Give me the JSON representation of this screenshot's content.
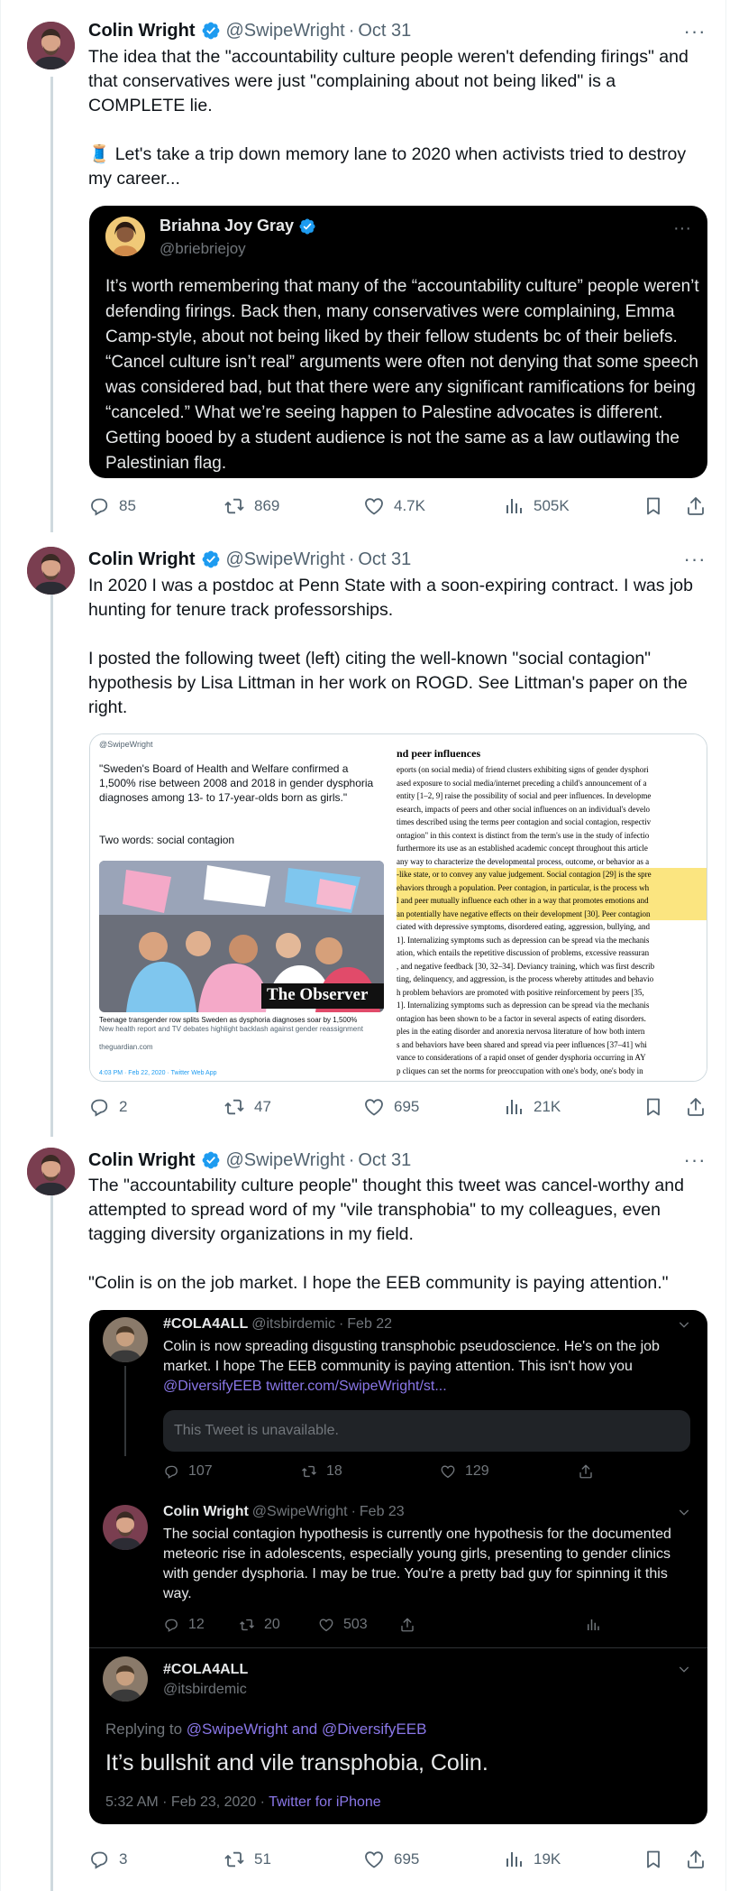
{
  "colors": {
    "accent": "#1d9bf0",
    "text": "#0f1419",
    "muted": "#536471",
    "dark_bg": "#000000",
    "purple_link": "#8a77e8"
  },
  "tweets": [
    {
      "author_name": "Colin Wright",
      "author_handle": "@SwipeWright",
      "date": "Oct 31",
      "paragraphs": [
        "The idea that the \"accountability culture people weren't defending firings\" and that conservatives were just \"complaining about not being liked\" is a COMPLETE lie.",
        "🧵 Let's take a trip down memory lane to 2020 when activists tried to destroy my career..."
      ],
      "quote": {
        "author_name": "Briahna Joy Gray",
        "author_handle": "@briebriejoy",
        "text": "It’s worth remembering that many of the “accountability culture” people weren’t defending firings. Back then, many conservatives were complaining, Emma Camp-style, about not being liked by their fellow students bc of their beliefs. “Cancel culture isn’t real” arguments were often not denying that some speech was considered bad, but that there were any significant ramifications for being “canceled.” What we’re seeing happen to Palestine advocates is different. Getting booed by a student audience is not the same as a law outlawing the Palestinian flag."
      },
      "stats": {
        "replies": "85",
        "retweets": "869",
        "likes": "4.7K",
        "views": "505K"
      }
    },
    {
      "author_name": "Colin Wright",
      "author_handle": "@SwipeWright",
      "date": "Oct 31",
      "paragraphs": [
        "In 2020 I was a postdoc at Penn State with a soon-expiring contract. I was job hunting for tenure track professorships.",
        "I posted the following tweet (left) citing the well-known \"social contagion\" hypothesis by Lisa Littman in her work on ROGD. See Littman's paper on the right."
      ],
      "image": {
        "left": {
          "handle": "@SwipeWright",
          "quote": "\"Sweden's Board of Health and Welfare confirmed a 1,500% rise between 2008 and 2018 in gender dysphoria diagnoses among 13- to 17-year-olds born as girls.\"",
          "words": "Two words: social contagion",
          "banner": "The Observer",
          "caption": "Teenage transgender row splits Sweden as dysphoria diagnoses soar by 1,500%",
          "subcaption": "New health report and TV debates highlight backlash against gender reassignment",
          "source": "theguardian.com",
          "footer": "4:03 PM · Feb 22, 2020 · Twitter Web App"
        },
        "right": {
          "heading": "nd peer influences",
          "lines": [
            "eports (on social media) of friend clusters exhibiting signs of gender dysphori",
            "ased exposure to social media/internet preceding a child's announcement of a",
            "entity [1–2, 9] raise the possibility of social and peer influences. In developme",
            "esearch, impacts of peers and other social influences on an individual's develo",
            "times described using the terms peer contagion and social contagion, respectiv",
            "ontagion\" in this context is distinct from the term's use in the study of infectio",
            " furthermore its use as an established academic concept throughout this article",
            " any way to characterize the developmental process, outcome, or behavior as a",
            "-like state, or to convey any value judgement. Social contagion [29] is the spre",
            "ehaviors through a population. Peer contagion, in particular, is the process wh",
            "l and peer mutually influence each other in a way that promotes emotions and",
            "an potentially have negative effects on their development [30]. Peer contagion",
            "ciated with depressive symptoms, disordered eating, aggression, bullying, and",
            "1]. Internalizing symptoms such as depression can be spread via the mechanis",
            "ation, which entails the repetitive discussion of problems, excessive reassuran",
            ", and negative feedback [30, 32–34]. Deviancy training, which was first describ",
            "ting, delinquency, and aggression, is the process whereby attitudes and behavio",
            "h problem behaviors are promoted with positive reinforcement by peers [35,",
            "1]. Internalizing symptoms such as depression can be spread via the mechanis",
            "ontagion has been shown to be a factor in several aspects of eating disorders.",
            "ples in the eating disorder and anorexia nervosa literature of how both intern",
            "s and behaviors have been shared and spread via peer influences [37–41] whi",
            "vance to considerations of a rapid onset of gender dysphoria occurring in AY",
            "p cliques can set the norms for preoccupation with one's body, one's body in"
          ]
        }
      },
      "stats": {
        "replies": "2",
        "retweets": "47",
        "likes": "695",
        "views": "21K"
      }
    },
    {
      "author_name": "Colin Wright",
      "author_handle": "@SwipeWright",
      "date": "Oct 31",
      "paragraphs": [
        "The \"accountability culture people\" thought this tweet was cancel-worthy and attempted to spread word of my \"vile transphobia\" to my colleagues, even tagging diversity organizations in my field.",
        "\"Colin is on the job market. I hope the EEB community is paying attention.\""
      ],
      "embed": {
        "t1": {
          "name": "#COLA4ALL",
          "handle": "@itsbirdemic",
          "date": "Feb 22",
          "text": "Colin is now spreading disgusting transphobic pseudoscience. He's on the job market. I hope The EEB community is paying attention. This isn't how you ",
          "link": "@DiversifyEEB twitter.com/SwipeWright/st...",
          "unavailable": "This Tweet is unavailable.",
          "replies": "107",
          "retweets": "18",
          "likes": "129"
        },
        "t2": {
          "name": "Colin Wright",
          "handle": "@SwipeWright",
          "date": "Feb 23",
          "text": "The social contagion hypothesis is currently one hypothesis for the documented meteoric rise in adolescents, especially young girls, presenting to gender clinics with gender dysphoria. I may be true. You're a pretty bad guy for spinning it this way.",
          "replies": "12",
          "retweets": "20",
          "likes": "503"
        },
        "t3": {
          "name": "#COLA4ALL",
          "handle": "@itsbirdemic",
          "replying_prefix": "Replying to ",
          "replying_to": "@SwipeWright and @DiversifyEEB",
          "text": "It’s bullshit and vile transphobia, Colin.",
          "timestamp": "5:32 AM · Feb 23, 2020 · ",
          "client": "Twitter for iPhone"
        }
      },
      "stats": {
        "replies": "3",
        "retweets": "51",
        "likes": "695",
        "views": "19K"
      }
    }
  ],
  "icons": [
    "verified-badge-icon",
    "more-icon",
    "reply-icon",
    "retweet-icon",
    "like-icon",
    "views-icon",
    "bookmark-icon",
    "share-icon",
    "chevron-down-icon"
  ]
}
